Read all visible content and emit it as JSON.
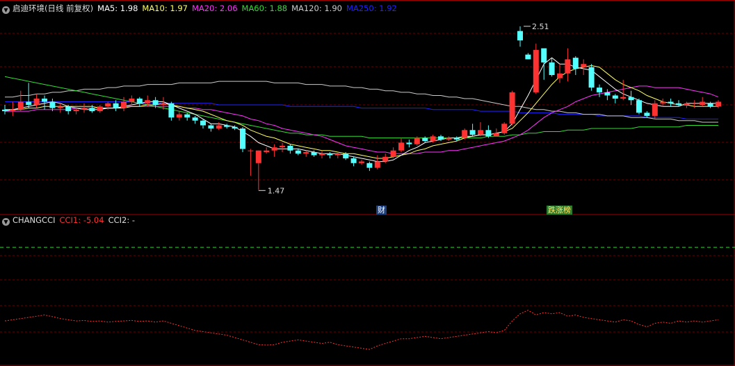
{
  "header": {
    "title": "启迪环境(日线 前复权)",
    "ma": [
      {
        "label": "MA5: 1.98",
        "color": "#ffffff"
      },
      {
        "label": "MA10: 1.97",
        "color": "#ffff66"
      },
      {
        "label": "MA20: 2.06",
        "color": "#ff33ff"
      },
      {
        "label": "MA60: 1.88",
        "color": "#33dd33"
      },
      {
        "label": "MA120: 1.90",
        "color": "#cccccc"
      },
      {
        "label": "MA250: 1.92",
        "color": "#2222ff"
      }
    ]
  },
  "indicator": {
    "name": "CHANGCCI",
    "cci1_label": "CCI1: -5.04",
    "cci2_label": "CCI2: -"
  },
  "badges": {
    "cai": "财",
    "list": "跌涨榜"
  },
  "colors": {
    "up": "#ff3232",
    "down": "#54ffff",
    "axis": "#a00000",
    "grid": "#6a0000",
    "ma5": "#ffffff",
    "ma10": "#ffff66",
    "ma20": "#ff33ff",
    "ma60": "#33dd33",
    "ma120": "#cccccc",
    "ma250": "#2222ff",
    "cci1": "#ff3232",
    "cci2": "#22dd22"
  },
  "chart_data": {
    "type": "candlestick",
    "price_range": [
      1.33,
      2.58
    ],
    "high_annotation": "2.51",
    "low_annotation": "1.47",
    "candles": [
      [
        1.98,
        1.97,
        2.01,
        1.95
      ],
      [
        1.97,
        1.98,
        2.03,
        1.94
      ],
      [
        1.98,
        2.03,
        2.1,
        1.97
      ],
      [
        2.03,
        2.01,
        2.15,
        1.99
      ],
      [
        2.01,
        2.05,
        2.08,
        1.99
      ],
      [
        2.05,
        2.03,
        2.07,
        1.98
      ],
      [
        2.03,
        1.99,
        2.05,
        1.97
      ],
      [
        1.99,
        2.0,
        2.02,
        1.96
      ],
      [
        2.0,
        1.97,
        2.01,
        1.95
      ],
      [
        1.97,
        1.98,
        2.0,
        1.95
      ],
      [
        1.98,
        1.99,
        2.02,
        1.96
      ],
      [
        1.99,
        1.97,
        2.01,
        1.96
      ],
      [
        1.97,
        2.0,
        2.01,
        1.96
      ],
      [
        2.0,
        2.02,
        2.03,
        1.98
      ],
      [
        2.02,
        1.99,
        2.04,
        1.97
      ],
      [
        1.99,
        2.03,
        2.06,
        1.97
      ],
      [
        2.03,
        2.05,
        2.07,
        2.01
      ],
      [
        2.05,
        2.02,
        2.06,
        2.0
      ],
      [
        2.02,
        2.04,
        2.07,
        2.0
      ],
      [
        2.04,
        2.01,
        2.06,
        1.99
      ],
      [
        2.01,
        2.02,
        2.06,
        1.98
      ],
      [
        2.02,
        1.93,
        2.03,
        1.91
      ],
      [
        1.93,
        1.95,
        1.97,
        1.91
      ],
      [
        1.95,
        1.93,
        1.96,
        1.91
      ],
      [
        1.93,
        1.91,
        1.94,
        1.89
      ],
      [
        1.91,
        1.88,
        1.92,
        1.86
      ],
      [
        1.88,
        1.86,
        1.89,
        1.84
      ],
      [
        1.86,
        1.88,
        1.9,
        1.85
      ],
      [
        1.88,
        1.87,
        1.89,
        1.86
      ],
      [
        1.87,
        1.86,
        1.88,
        1.85
      ],
      [
        1.86,
        1.73,
        1.87,
        1.71
      ],
      [
        1.72,
        1.72,
        1.73,
        1.56
      ],
      [
        1.64,
        1.72,
        1.72,
        1.47
      ],
      [
        1.71,
        1.72,
        1.74,
        1.7
      ],
      [
        1.72,
        1.74,
        1.76,
        1.68
      ],
      [
        1.74,
        1.75,
        1.77,
        1.71
      ],
      [
        1.75,
        1.72,
        1.76,
        1.7
      ],
      [
        1.72,
        1.7,
        1.73,
        1.69
      ],
      [
        1.7,
        1.71,
        1.72,
        1.68
      ],
      [
        1.71,
        1.69,
        1.72,
        1.68
      ],
      [
        1.69,
        1.7,
        1.72,
        1.67
      ],
      [
        1.7,
        1.69,
        1.71,
        1.67
      ],
      [
        1.69,
        1.7,
        1.71,
        1.67
      ],
      [
        1.7,
        1.67,
        1.71,
        1.66
      ],
      [
        1.67,
        1.64,
        1.68,
        1.62
      ],
      [
        1.64,
        1.65,
        1.66,
        1.63
      ],
      [
        1.64,
        1.61,
        1.65,
        1.59
      ],
      [
        1.61,
        1.65,
        1.69,
        1.6
      ],
      [
        1.65,
        1.68,
        1.7,
        1.64
      ],
      [
        1.68,
        1.72,
        1.74,
        1.67
      ],
      [
        1.72,
        1.77,
        1.8,
        1.71
      ],
      [
        1.77,
        1.76,
        1.79,
        1.74
      ],
      [
        1.76,
        1.8,
        1.81,
        1.75
      ],
      [
        1.8,
        1.78,
        1.81,
        1.77
      ],
      [
        1.78,
        1.81,
        1.82,
        1.77
      ],
      [
        1.81,
        1.79,
        1.82,
        1.78
      ],
      [
        1.79,
        1.8,
        1.81,
        1.78
      ],
      [
        1.8,
        1.79,
        1.81,
        1.78
      ],
      [
        1.8,
        1.85,
        1.86,
        1.79
      ],
      [
        1.85,
        1.82,
        1.89,
        1.81
      ],
      [
        1.82,
        1.85,
        1.9,
        1.81
      ],
      [
        1.85,
        1.81,
        1.88,
        1.8
      ],
      [
        1.81,
        1.83,
        1.86,
        1.81
      ],
      [
        1.83,
        1.89,
        1.9,
        1.82
      ],
      [
        1.89,
        2.09,
        2.1,
        1.88
      ],
      [
        2.48,
        2.42,
        2.51,
        2.38
      ],
      [
        2.33,
        2.3,
        2.34,
        2.3
      ],
      [
        2.09,
        2.36,
        2.4,
        2.08
      ],
      [
        2.37,
        2.28,
        2.35,
        2.17
      ],
      [
        2.28,
        2.2,
        2.31,
        2.19
      ],
      [
        2.18,
        2.21,
        2.27,
        2.15
      ],
      [
        2.21,
        2.3,
        2.37,
        2.16
      ],
      [
        2.31,
        2.24,
        2.32,
        2.2
      ],
      [
        2.25,
        2.27,
        2.3,
        2.2
      ],
      [
        2.25,
        2.12,
        2.27,
        2.1
      ],
      [
        2.12,
        2.09,
        2.14,
        2.06
      ],
      [
        2.09,
        2.07,
        2.11,
        2.04
      ],
      [
        2.07,
        2.05,
        2.08,
        2.02
      ],
      [
        2.05,
        2.06,
        2.17,
        2.04
      ],
      [
        2.06,
        2.04,
        2.1,
        2.01
      ],
      [
        2.04,
        1.96,
        2.05,
        1.95
      ],
      [
        1.96,
        1.94,
        1.97,
        1.93
      ],
      [
        1.94,
        2.02,
        2.04,
        1.92
      ],
      [
        2.02,
        2.03,
        2.05,
        2.0
      ],
      [
        2.03,
        2.02,
        2.05,
        2.0
      ],
      [
        2.02,
        2.01,
        2.04,
        2.0
      ],
      [
        2.01,
        2.02,
        2.03,
        1.99
      ],
      [
        2.02,
        2.02,
        2.04,
        1.99
      ],
      [
        2.01,
        2.03,
        2.06,
        2.0
      ],
      [
        2.02,
        2.0,
        2.03,
        1.99
      ],
      [
        2.0,
        2.03,
        2.04,
        1.99
      ]
    ],
    "ma5": [
      1.97,
      1.98,
      1.99,
      2.0,
      2.01,
      2.02,
      2.03,
      2.02,
      2.0,
      1.99,
      1.98,
      1.98,
      1.98,
      1.99,
      1.99,
      2.0,
      2.01,
      2.02,
      2.03,
      2.03,
      2.03,
      2.01,
      1.99,
      1.97,
      1.95,
      1.92,
      1.89,
      1.89,
      1.88,
      1.87,
      1.84,
      1.81,
      1.77,
      1.75,
      1.73,
      1.73,
      1.73,
      1.73,
      1.72,
      1.71,
      1.7,
      1.7,
      1.7,
      1.69,
      1.68,
      1.67,
      1.66,
      1.65,
      1.65,
      1.66,
      1.69,
      1.72,
      1.74,
      1.77,
      1.78,
      1.79,
      1.8,
      1.8,
      1.81,
      1.81,
      1.82,
      1.82,
      1.83,
      1.84,
      1.89,
      1.98,
      2.07,
      2.17,
      2.27,
      2.31,
      2.27,
      2.27,
      2.25,
      2.24,
      2.23,
      2.19,
      2.15,
      2.11,
      2.08,
      2.06,
      2.04,
      2.02,
      2.01,
      2.0,
      2.0,
      2.0,
      2.02,
      2.02,
      2.02,
      2.02,
      2.02
    ],
    "ma10": [
      1.98,
      1.98,
      1.98,
      1.99,
      1.99,
      2.0,
      2.0,
      2.0,
      2.0,
      2.0,
      2.0,
      2.0,
      1.99,
      1.99,
      1.99,
      1.99,
      2.0,
      2.0,
      2.01,
      2.01,
      2.02,
      2.01,
      2.0,
      1.99,
      1.98,
      1.97,
      1.95,
      1.93,
      1.91,
      1.9,
      1.88,
      1.85,
      1.83,
      1.81,
      1.8,
      1.78,
      1.76,
      1.75,
      1.74,
      1.73,
      1.72,
      1.72,
      1.71,
      1.7,
      1.7,
      1.69,
      1.68,
      1.67,
      1.67,
      1.68,
      1.69,
      1.7,
      1.72,
      1.73,
      1.75,
      1.76,
      1.77,
      1.78,
      1.8,
      1.81,
      1.82,
      1.82,
      1.83,
      1.84,
      1.86,
      1.91,
      1.96,
      2.02,
      2.08,
      2.14,
      2.19,
      2.22,
      2.24,
      2.25,
      2.26,
      2.25,
      2.21,
      2.17,
      2.14,
      2.12,
      2.1,
      2.07,
      2.05,
      2.03,
      2.02,
      2.01,
      2.01,
      2.0,
      2.0,
      2.0,
      2.0
    ],
    "ma20": [
      1.97,
      1.97,
      1.97,
      1.97,
      1.98,
      1.98,
      1.98,
      1.98,
      1.98,
      1.99,
      1.99,
      1.99,
      1.99,
      1.99,
      1.99,
      2.0,
      2.0,
      2.0,
      2.0,
      2.0,
      2.0,
      2.0,
      2.0,
      1.99,
      1.99,
      1.98,
      1.98,
      1.97,
      1.96,
      1.95,
      1.94,
      1.92,
      1.91,
      1.89,
      1.88,
      1.86,
      1.85,
      1.84,
      1.83,
      1.82,
      1.81,
      1.79,
      1.77,
      1.75,
      1.74,
      1.73,
      1.72,
      1.71,
      1.71,
      1.7,
      1.7,
      1.7,
      1.7,
      1.71,
      1.71,
      1.71,
      1.72,
      1.72,
      1.73,
      1.74,
      1.75,
      1.76,
      1.77,
      1.78,
      1.8,
      1.82,
      1.85,
      1.89,
      1.93,
      1.96,
      1.98,
      2.0,
      2.03,
      2.05,
      2.07,
      2.08,
      2.09,
      2.1,
      2.11,
      2.12,
      2.13,
      2.13,
      2.12,
      2.12,
      2.12,
      2.12,
      2.11,
      2.1,
      2.09,
      2.08,
      2.06
    ],
    "ma60": [
      2.19,
      2.18,
      2.17,
      2.16,
      2.15,
      2.14,
      2.13,
      2.12,
      2.11,
      2.1,
      2.09,
      2.08,
      2.07,
      2.06,
      2.05,
      2.04,
      2.03,
      2.02,
      2.01,
      2.0,
      1.99,
      1.98,
      1.97,
      1.96,
      1.95,
      1.94,
      1.93,
      1.92,
      1.91,
      1.9,
      1.89,
      1.88,
      1.87,
      1.86,
      1.85,
      1.84,
      1.83,
      1.83,
      1.82,
      1.82,
      1.82,
      1.81,
      1.81,
      1.81,
      1.81,
      1.81,
      1.8,
      1.8,
      1.8,
      1.8,
      1.8,
      1.8,
      1.8,
      1.8,
      1.8,
      1.8,
      1.8,
      1.8,
      1.8,
      1.8,
      1.8,
      1.81,
      1.81,
      1.81,
      1.82,
      1.82,
      1.83,
      1.83,
      1.84,
      1.84,
      1.84,
      1.85,
      1.85,
      1.85,
      1.86,
      1.86,
      1.86,
      1.86,
      1.86,
      1.86,
      1.87,
      1.87,
      1.87,
      1.87,
      1.87,
      1.87,
      1.88,
      1.88,
      1.88,
      1.88,
      1.88
    ],
    "ma120": [
      2.06,
      2.06,
      2.07,
      2.07,
      2.08,
      2.08,
      2.09,
      2.09,
      2.1,
      2.1,
      2.11,
      2.11,
      2.11,
      2.12,
      2.12,
      2.13,
      2.13,
      2.13,
      2.14,
      2.14,
      2.14,
      2.14,
      2.15,
      2.15,
      2.15,
      2.15,
      2.15,
      2.16,
      2.16,
      2.16,
      2.16,
      2.16,
      2.16,
      2.16,
      2.15,
      2.15,
      2.15,
      2.15,
      2.14,
      2.14,
      2.14,
      2.13,
      2.13,
      2.13,
      2.12,
      2.12,
      2.11,
      2.11,
      2.1,
      2.1,
      2.09,
      2.09,
      2.08,
      2.08,
      2.07,
      2.07,
      2.06,
      2.06,
      2.05,
      2.05,
      2.04,
      2.03,
      2.02,
      2.01,
      2.0,
      2.0,
      1.99,
      1.98,
      1.98,
      1.97,
      1.97,
      1.96,
      1.96,
      1.95,
      1.95,
      1.95,
      1.94,
      1.94,
      1.94,
      1.93,
      1.93,
      1.93,
      1.92,
      1.92,
      1.92,
      1.91,
      1.91,
      1.91,
      1.9,
      1.9,
      1.9
    ],
    "ma250": [
      2.03,
      2.03,
      2.03,
      2.03,
      2.03,
      2.03,
      2.03,
      2.03,
      2.03,
      2.03,
      2.03,
      2.03,
      2.03,
      2.03,
      2.03,
      2.03,
      2.03,
      2.02,
      2.02,
      2.02,
      2.02,
      2.02,
      2.02,
      2.02,
      2.02,
      2.02,
      2.02,
      2.01,
      2.01,
      2.01,
      2.01,
      2.01,
      2.01,
      2.01,
      2.01,
      2.01,
      2.0,
      2.0,
      2.0,
      2.0,
      2.0,
      2.0,
      2.0,
      2.0,
      2.0,
      1.99,
      1.99,
      1.99,
      1.99,
      1.99,
      1.99,
      1.99,
      1.99,
      1.99,
      1.98,
      1.98,
      1.98,
      1.98,
      1.98,
      1.98,
      1.97,
      1.97,
      1.97,
      1.97,
      1.97,
      1.96,
      1.96,
      1.96,
      1.96,
      1.96,
      1.95,
      1.95,
      1.95,
      1.95,
      1.95,
      1.94,
      1.94,
      1.94,
      1.94,
      1.94,
      1.94,
      1.93,
      1.93,
      1.93,
      1.93,
      1.93,
      1.92,
      1.92,
      1.92,
      1.92,
      1.92
    ],
    "cci_range": [
      -200,
      400
    ],
    "cci1": [
      -10,
      -5,
      0,
      5,
      10,
      15,
      8,
      0,
      -5,
      -10,
      -8,
      -12,
      -10,
      -15,
      -12,
      -10,
      -8,
      -12,
      -10,
      -15,
      -10,
      -20,
      -30,
      -40,
      -50,
      -55,
      -60,
      -65,
      -70,
      -80,
      -90,
      -100,
      -110,
      -112,
      -110,
      -100,
      -95,
      -90,
      -95,
      -100,
      -105,
      -100,
      -110,
      -115,
      -120,
      -125,
      -130,
      -115,
      -105,
      -95,
      -85,
      -85,
      -80,
      -75,
      -80,
      -85,
      -80,
      -75,
      -70,
      -65,
      -60,
      -55,
      -60,
      -50,
      -10,
      20,
      35,
      15,
      25,
      20,
      25,
      10,
      15,
      5,
      0,
      -5,
      -10,
      -15,
      -5,
      -10,
      -25,
      -35,
      -20,
      -15,
      -20,
      -10,
      -15,
      -10,
      -15,
      -10,
      -5
    ],
    "cci2": [],
    "cci_ref_line": 300
  }
}
